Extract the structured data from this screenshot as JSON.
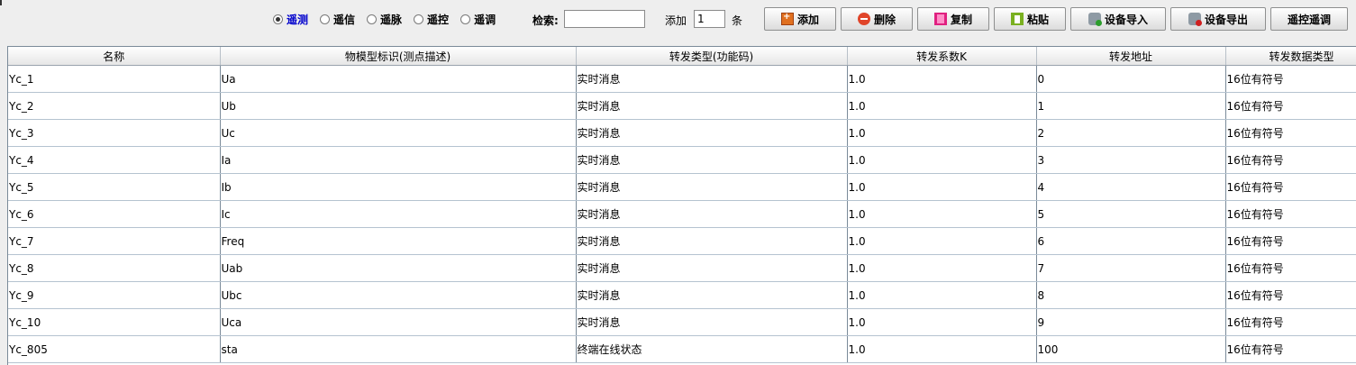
{
  "radios": [
    {
      "label": "遥测",
      "checked": true
    },
    {
      "label": "遥信",
      "checked": false
    },
    {
      "label": "遥脉",
      "checked": false
    },
    {
      "label": "遥控",
      "checked": false
    },
    {
      "label": "遥调",
      "checked": false
    }
  ],
  "search": {
    "label": "检索:",
    "value": ""
  },
  "add": {
    "label": "添加",
    "count": "1",
    "unit": "条"
  },
  "buttons": {
    "add": "添加",
    "delete": "删除",
    "copy": "复制",
    "paste": "粘贴",
    "import": "设备导入",
    "export": "设备导出",
    "remote_control": "遥控遥调"
  },
  "table": {
    "columns": [
      "名称",
      "物模型标识(测点描述)",
      "转发类型(功能码)",
      "转发系数K",
      "转发地址",
      "转发数据类型"
    ],
    "rows": [
      [
        "Yc_1",
        "Ua",
        "实时消息",
        "1.0",
        "0",
        "16位有符号"
      ],
      [
        "Yc_2",
        "Ub",
        "实时消息",
        "1.0",
        "1",
        "16位有符号"
      ],
      [
        "Yc_3",
        "Uc",
        "实时消息",
        "1.0",
        "2",
        "16位有符号"
      ],
      [
        "Yc_4",
        "Ia",
        "实时消息",
        "1.0",
        "3",
        "16位有符号"
      ],
      [
        "Yc_5",
        "Ib",
        "实时消息",
        "1.0",
        "4",
        "16位有符号"
      ],
      [
        "Yc_6",
        "Ic",
        "实时消息",
        "1.0",
        "5",
        "16位有符号"
      ],
      [
        "Yc_7",
        "Freq",
        "实时消息",
        "1.0",
        "6",
        "16位有符号"
      ],
      [
        "Yc_8",
        "Uab",
        "实时消息",
        "1.0",
        "7",
        "16位有符号"
      ],
      [
        "Yc_9",
        "Ubc",
        "实时消息",
        "1.0",
        "8",
        "16位有符号"
      ],
      [
        "Yc_10",
        "Uca",
        "实时消息",
        "1.0",
        "9",
        "16位有符号"
      ],
      [
        "Yc_805",
        "sta",
        "终端在线状态",
        "1.0",
        "100",
        "16位有符号"
      ]
    ]
  }
}
